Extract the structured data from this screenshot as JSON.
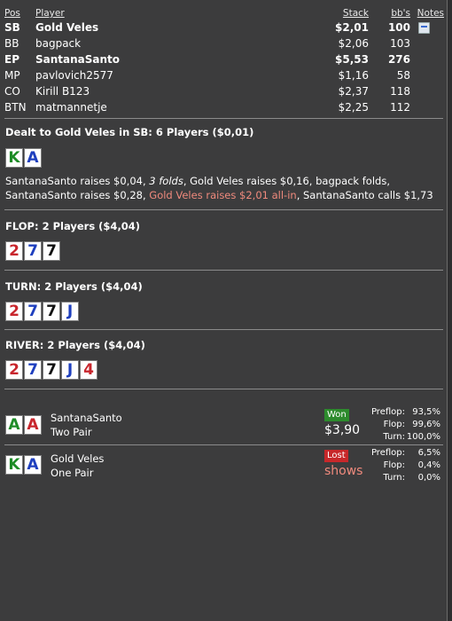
{
  "header": {
    "pos": "Pos",
    "player": "Player",
    "stack": "Stack",
    "bbs": "bb's",
    "notes": "Notes"
  },
  "players": [
    {
      "pos": "SB",
      "name": "Gold Veles",
      "stack": "$2,01",
      "bbs": "100",
      "bold": true,
      "note_icon": true
    },
    {
      "pos": "BB",
      "name": "bagpack",
      "stack": "$2,06",
      "bbs": "103"
    },
    {
      "pos": "EP",
      "name": "SantanaSanto",
      "stack": "$5,53",
      "bbs": "276",
      "bold": true
    },
    {
      "pos": "MP",
      "name": "pavlovich2577",
      "stack": "$1,16",
      "bbs": "58"
    },
    {
      "pos": "CO",
      "name": "Kirill B123",
      "stack": "$2,37",
      "bbs": "118"
    },
    {
      "pos": "BTN",
      "name": "matmannetje",
      "stack": "$2,25",
      "bbs": "112"
    }
  ],
  "preflop": {
    "title": "Dealt to Gold Veles in SB: 6 Players ($0,01)",
    "cards": [
      {
        "rank": "K",
        "suit": "green"
      },
      {
        "rank": "A",
        "suit": "blue"
      }
    ],
    "actions": {
      "a1": "SantanaSanto raises $0,04, ",
      "a2": "3 folds",
      "a3": ", Gold Veles raises $0,16, bagpack folds, SantanaSanto raises $0,28, ",
      "a4": "Gold Veles raises $2,01 all-in",
      "a5": ", SantanaSanto calls $1,73"
    }
  },
  "flop": {
    "title": "FLOP: 2 Players ($4,04)",
    "cards": [
      {
        "rank": "2",
        "suit": "red"
      },
      {
        "rank": "7",
        "suit": "blue"
      },
      {
        "rank": "7",
        "suit": "black"
      }
    ]
  },
  "turn": {
    "title": "TURN: 2 Players ($4,04)",
    "cards": [
      {
        "rank": "2",
        "suit": "red"
      },
      {
        "rank": "7",
        "suit": "blue"
      },
      {
        "rank": "7",
        "suit": "black"
      },
      {
        "rank": "J",
        "suit": "blue"
      }
    ]
  },
  "river": {
    "title": "RIVER: 2 Players ($4,04)",
    "cards": [
      {
        "rank": "2",
        "suit": "red"
      },
      {
        "rank": "7",
        "suit": "blue"
      },
      {
        "rank": "7",
        "suit": "black"
      },
      {
        "rank": "J",
        "suit": "blue"
      },
      {
        "rank": "4",
        "suit": "red"
      }
    ]
  },
  "showdown": [
    {
      "name": "SantanaSanto",
      "hand": "Two Pair",
      "cards": [
        {
          "rank": "A",
          "suit": "green"
        },
        {
          "rank": "A",
          "suit": "red"
        }
      ],
      "result": "Won",
      "amount": "$3,90",
      "equity": {
        "preflop_label": "Preflop:",
        "preflop": "93,5%",
        "flop_label": "Flop:",
        "flop": "99,6%",
        "turn_label": "Turn:",
        "turn": "100,0%"
      }
    },
    {
      "name": "Gold Veles",
      "hand": "One Pair",
      "cards": [
        {
          "rank": "K",
          "suit": "green"
        },
        {
          "rank": "A",
          "suit": "blue"
        }
      ],
      "result": "Lost",
      "amount": "shows",
      "equity": {
        "preflop_label": "Preflop:",
        "preflop": "6,5%",
        "flop_label": "Flop:",
        "flop": "0,4%",
        "turn_label": "Turn:",
        "turn": "0,0%"
      }
    }
  ],
  "colors": {
    "background": "#3c3c3d",
    "red_action": "#f08a7d",
    "won": "#2d8b2d",
    "lost": "#c7282a"
  }
}
